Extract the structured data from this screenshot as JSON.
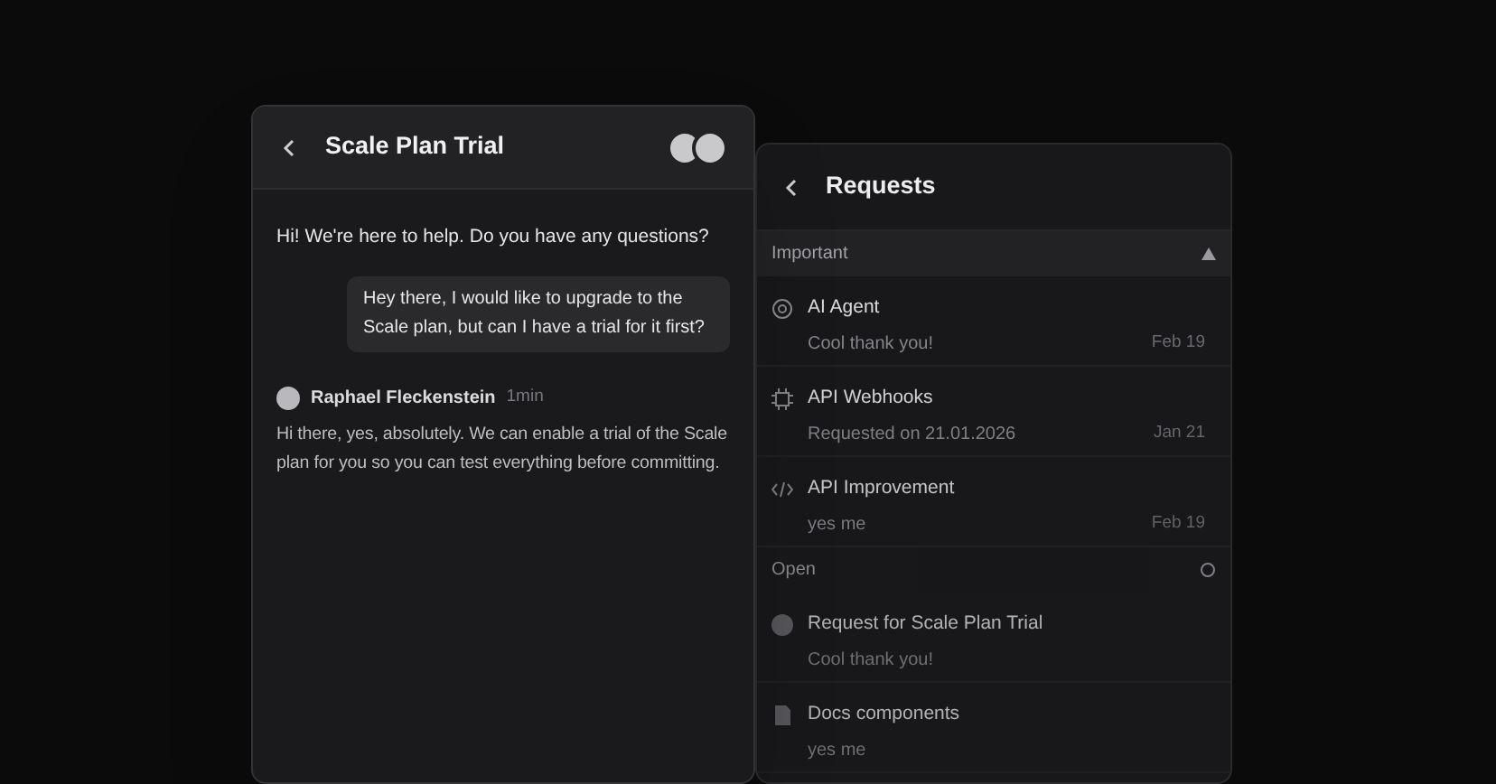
{
  "chat": {
    "title": "Scale Plan Trial",
    "messages": [
      {
        "kind": "bot",
        "text": "Hi! We're here to help. Do you have any questions?"
      },
      {
        "kind": "user",
        "text": "Hey there, I would like to upgrade to the Scale plan, but can I have a trial for it first?"
      },
      {
        "kind": "agent",
        "author": "Raphael Fleckenstein",
        "time": "1min",
        "text": "Hi there, yes, absolutely. We can enable a trial of the Scale plan for you so you can test everything before committing."
      }
    ]
  },
  "requests": {
    "title": "Requests",
    "sections": [
      {
        "kind": "important",
        "label": "Important",
        "items": [
          {
            "title": "AI Agent",
            "preview": "Cool thank you!",
            "date": "Feb 19"
          },
          {
            "title": "API Webhooks",
            "preview": "Requested on 21.01.2026",
            "date": "Jan 21"
          },
          {
            "title": "API Improvement",
            "preview": "yes me",
            "date": "Feb 19"
          }
        ]
      },
      {
        "kind": "open",
        "label": "Open",
        "items": [
          {
            "title": "Request for Scale Plan Trial",
            "preview": "Cool thank you!"
          },
          {
            "title": "Docs components",
            "preview": "yes me"
          }
        ]
      }
    ]
  }
}
